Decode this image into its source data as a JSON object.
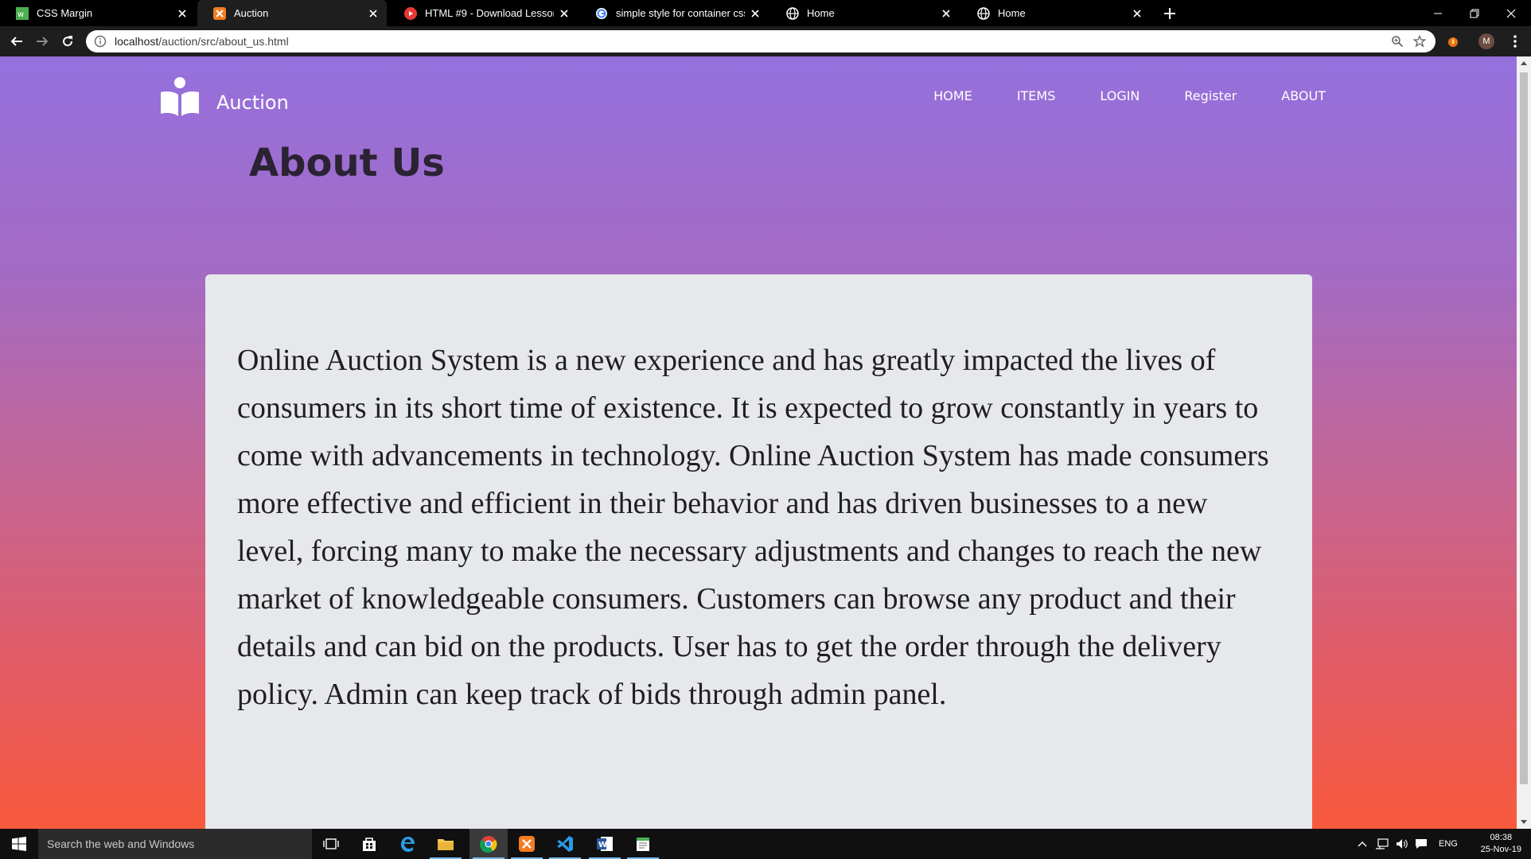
{
  "browser": {
    "tabs": [
      {
        "title": "CSS Margin",
        "active": false
      },
      {
        "title": "Auction",
        "active": true
      },
      {
        "title": "HTML #9 - Download Lesson Ma",
        "active": false
      },
      {
        "title": "simple style for container css - G",
        "active": false
      },
      {
        "title": "Home",
        "active": false
      },
      {
        "title": "Home",
        "active": false
      }
    ],
    "url_host": "localhost",
    "url_path": "/auction/src/about_us.html",
    "profile_initial": "M"
  },
  "site": {
    "brand": "Auction",
    "nav": [
      "HOME",
      "ITEMS",
      "LOGIN",
      "Register",
      "ABOUT"
    ],
    "heading": "About Us",
    "body": "Online Auction System is a new experience and has greatly impacted the lives of consumers in its short time of existence. It is expected to grow constantly in years to come with advancements in technology. Online Auction System has made consumers more effective and efficient in their behavior and has driven businesses to a new level, forcing many to make the necessary adjustments and changes to reach the new market of knowledgeable consumers. Customers can browse any product and their details and can bid on the products. User has to get the order through the delivery policy. Admin can keep track of bids through admin panel."
  },
  "taskbar": {
    "search_placeholder": "Search the web and Windows",
    "language": "ENG",
    "time": "08:38",
    "date": "25-Nov-19"
  },
  "colors": {
    "gradient_top": "#9570dd",
    "gradient_bottom": "#f85a3c",
    "card": "#e6e8ec",
    "heading": "#2b2233"
  }
}
